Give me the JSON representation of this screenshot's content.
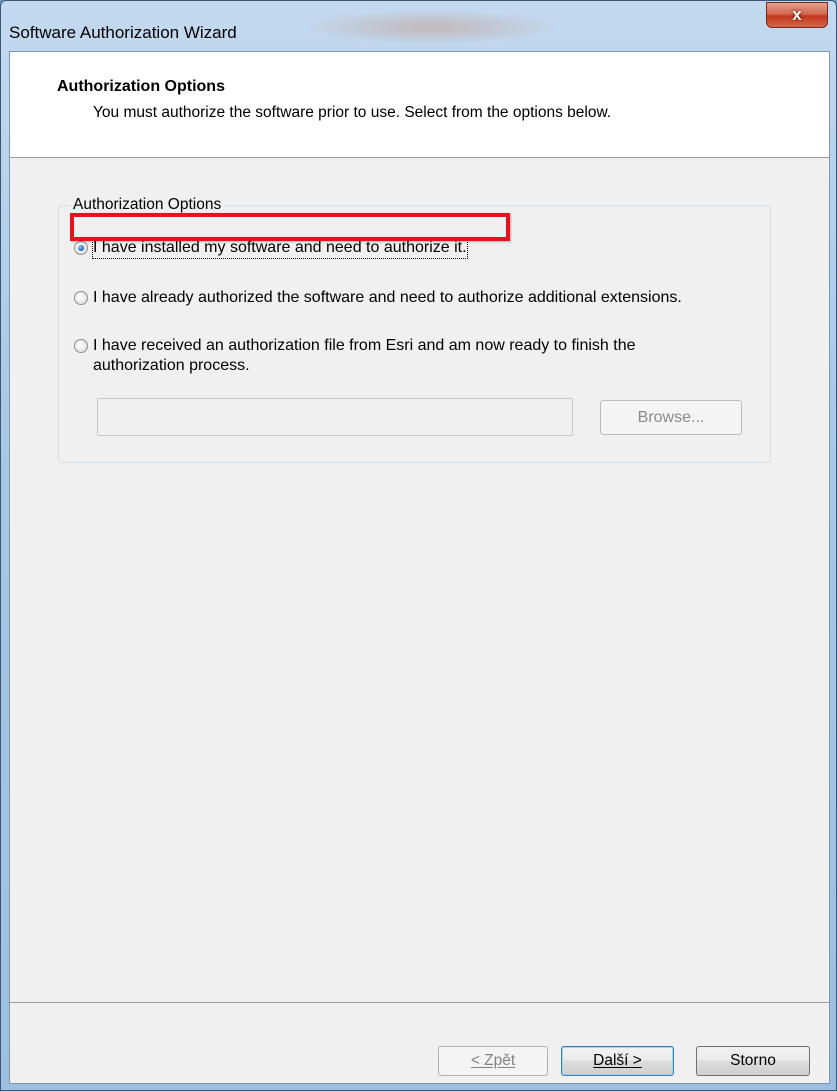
{
  "window": {
    "title": "Software Authorization Wizard",
    "close_label": "x"
  },
  "header": {
    "title": "Authorization Options",
    "subtitle": "You must authorize the software prior to use. Select from the options below."
  },
  "group": {
    "legend": "Authorization Options",
    "options": [
      {
        "label": "I have installed my software and need to authorize it.",
        "selected": true
      },
      {
        "label": "I have already authorized the software and need to authorize additional extensions.",
        "selected": false
      },
      {
        "label": "I have received an authorization file from Esri and am now ready to finish the",
        "label_line2": "authorization process.",
        "selected": false
      }
    ],
    "file_path_value": "",
    "browse_label": "Browse..."
  },
  "footer": {
    "back_label": "< Zpět",
    "next_label": "Další >",
    "cancel_label": "Storno"
  },
  "colors": {
    "highlight": "#e8111c",
    "accent": "#1f6fc7"
  }
}
